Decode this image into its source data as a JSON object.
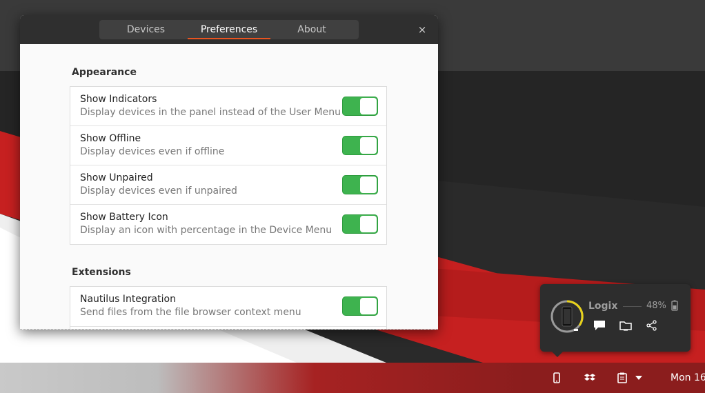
{
  "window": {
    "tabs": [
      {
        "label": "Devices"
      },
      {
        "label": "Preferences"
      },
      {
        "label": "About"
      }
    ],
    "active_tab": "Preferences",
    "close_glyph": "×"
  },
  "appearance": {
    "title": "Appearance",
    "rows": [
      {
        "title": "Show Indicators",
        "subtitle": "Display devices in the panel instead of the User Menu",
        "enabled": true
      },
      {
        "title": "Show Offline",
        "subtitle": "Display devices even if offline",
        "enabled": true
      },
      {
        "title": "Show Unpaired",
        "subtitle": "Display devices even if unpaired",
        "enabled": true
      },
      {
        "title": "Show Battery Icon",
        "subtitle": "Display an icon with percentage in the Device Menu",
        "enabled": true
      }
    ]
  },
  "extensions": {
    "title": "Extensions",
    "rows": [
      {
        "title": "Nautilus Integration",
        "subtitle": "Send files from the file browser context menu",
        "enabled": true
      }
    ]
  },
  "device_popup": {
    "name": "Logix",
    "battery": "48%",
    "actions": [
      "message-icon",
      "browse-files-icon",
      "share-icon"
    ]
  },
  "panel": {
    "clock": "Mon 16",
    "icons": [
      "phone-icon",
      "dropbox-icon",
      "clipboard-icon",
      "dropdown-arrow-icon"
    ]
  },
  "colors": {
    "accent": "#e95420",
    "switch_on": "#3eb34f",
    "wallpaper_red": "#c62020"
  }
}
